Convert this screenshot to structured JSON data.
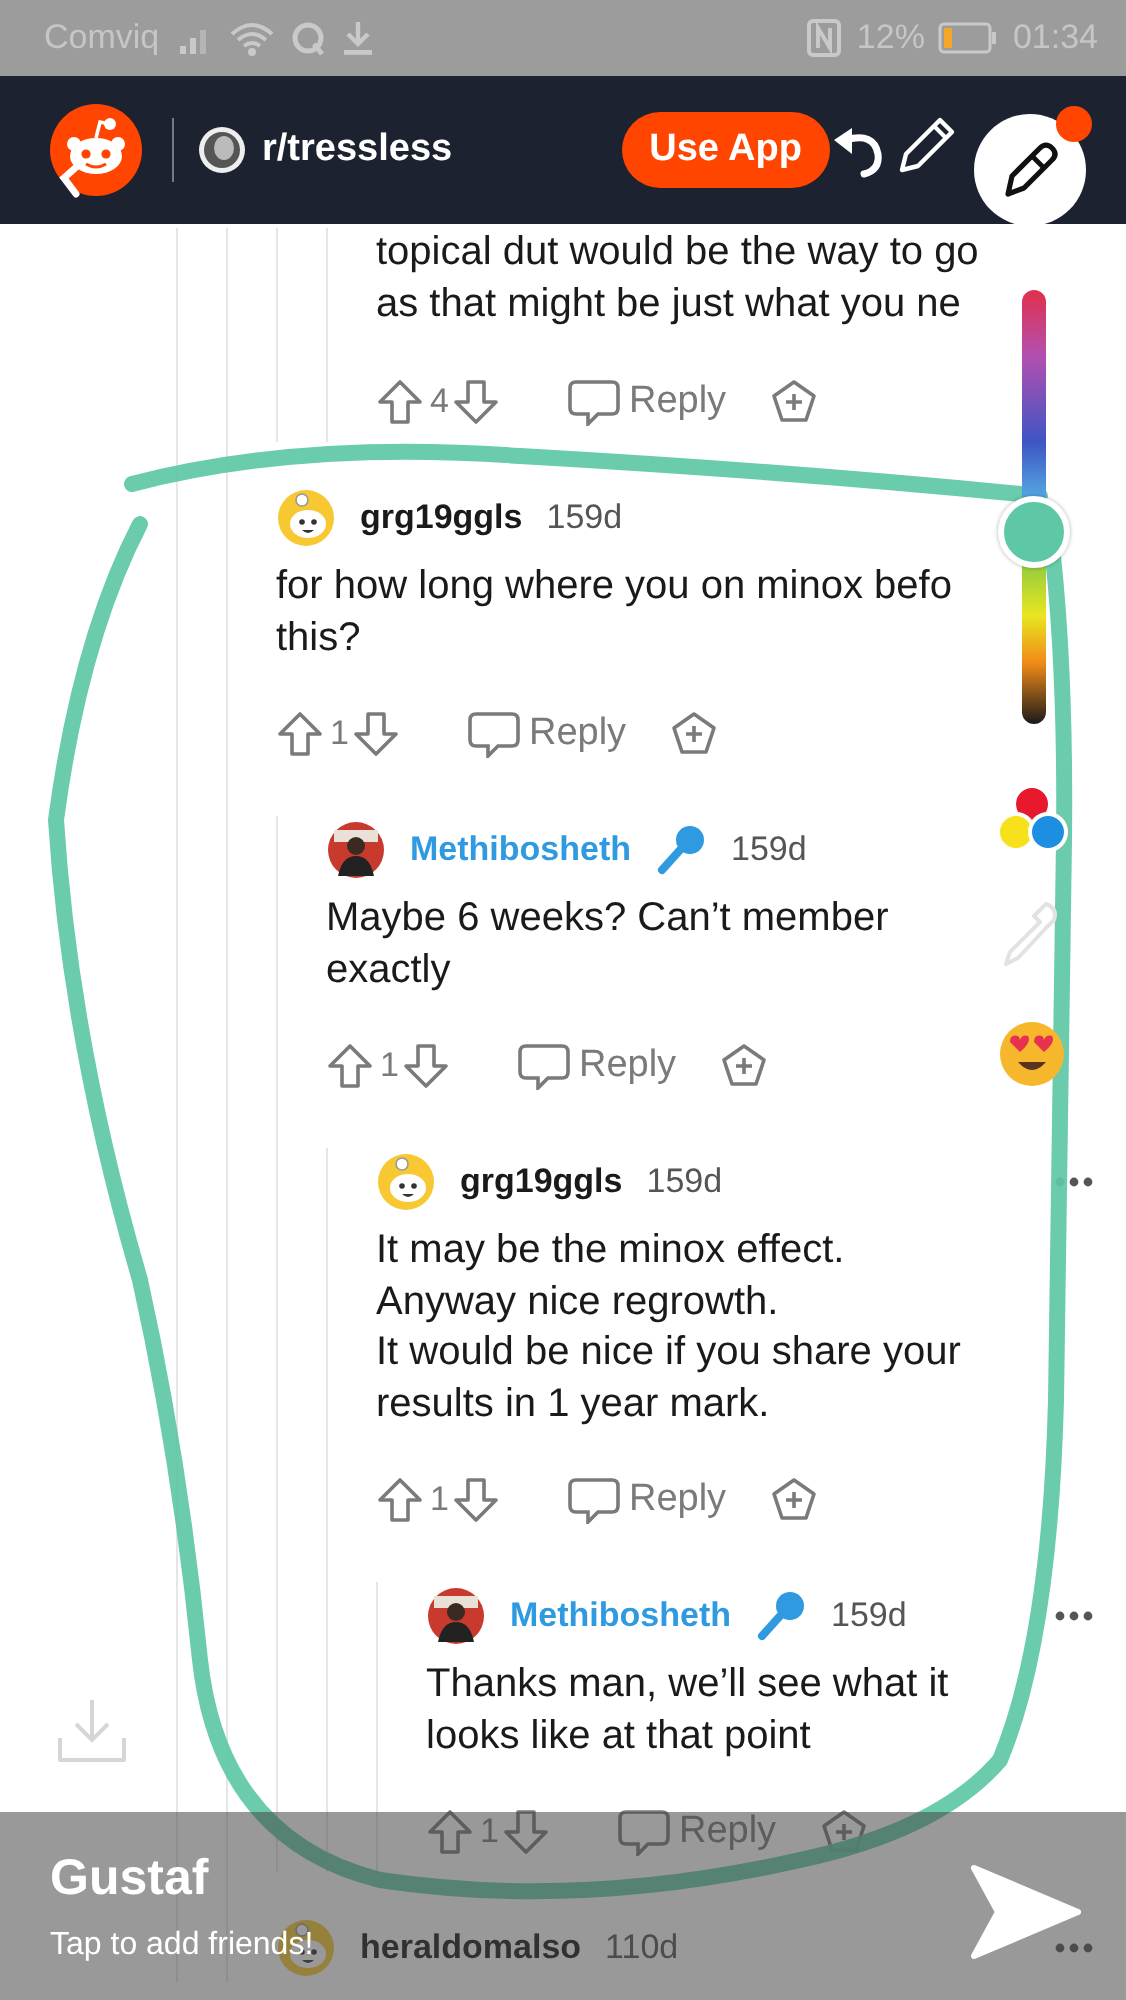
{
  "status_bar": {
    "carrier": "Comviq",
    "battery": "12%",
    "time": "01:34"
  },
  "header": {
    "subreddit": "r/tressless",
    "use_app_button": "Use App"
  },
  "comments": [
    {
      "kind": "fragment",
      "body": "topical dut would be the way to go\nas that might be just what you ne",
      "votes": "4",
      "reply": "Reply"
    },
    {
      "kind": "comment",
      "avatar": {
        "kind": "snoo"
      },
      "user": "grg19ggls",
      "op": false,
      "mic": false,
      "age": "159d",
      "body": "for how long where you on minox befo\nthis?",
      "votes": "1",
      "reply": "Reply",
      "menu": false,
      "children": [
        {
          "kind": "comment",
          "avatar": {
            "kind": "photo"
          },
          "user": "Methibosheth",
          "op": true,
          "mic": true,
          "age": "159d",
          "body": "Maybe 6 weeks? Can’t member\nexactly",
          "votes": "1",
          "reply": "Reply",
          "menu": false,
          "children": [
            {
              "kind": "comment",
              "avatar": {
                "kind": "snoo"
              },
              "user": "grg19ggls",
              "op": false,
              "mic": false,
              "age": "159d",
              "body": "It may be the minox effect.\nAnyway nice regrowth.\nIt would be nice if you share your\nresults in 1 year mark.",
              "votes": "1",
              "reply": "Reply",
              "menu": true,
              "children": [
                {
                  "kind": "comment",
                  "avatar": {
                    "kind": "photo"
                  },
                  "user": "Methibosheth",
                  "op": true,
                  "mic": true,
                  "age": "159d",
                  "body": "Thanks man, we’ll see what it\nlooks like at that point",
                  "votes": "1",
                  "reply": "Reply",
                  "menu": true
                }
              ]
            }
          ]
        }
      ]
    },
    {
      "kind": "comment",
      "avatar": {
        "kind": "snoo"
      },
      "user": "heraldomalso",
      "op": false,
      "mic": false,
      "age": "110d",
      "menu": true
    }
  ],
  "recipient_bar": {
    "name": "Gustaf",
    "hint": "Tap to add friends!"
  }
}
